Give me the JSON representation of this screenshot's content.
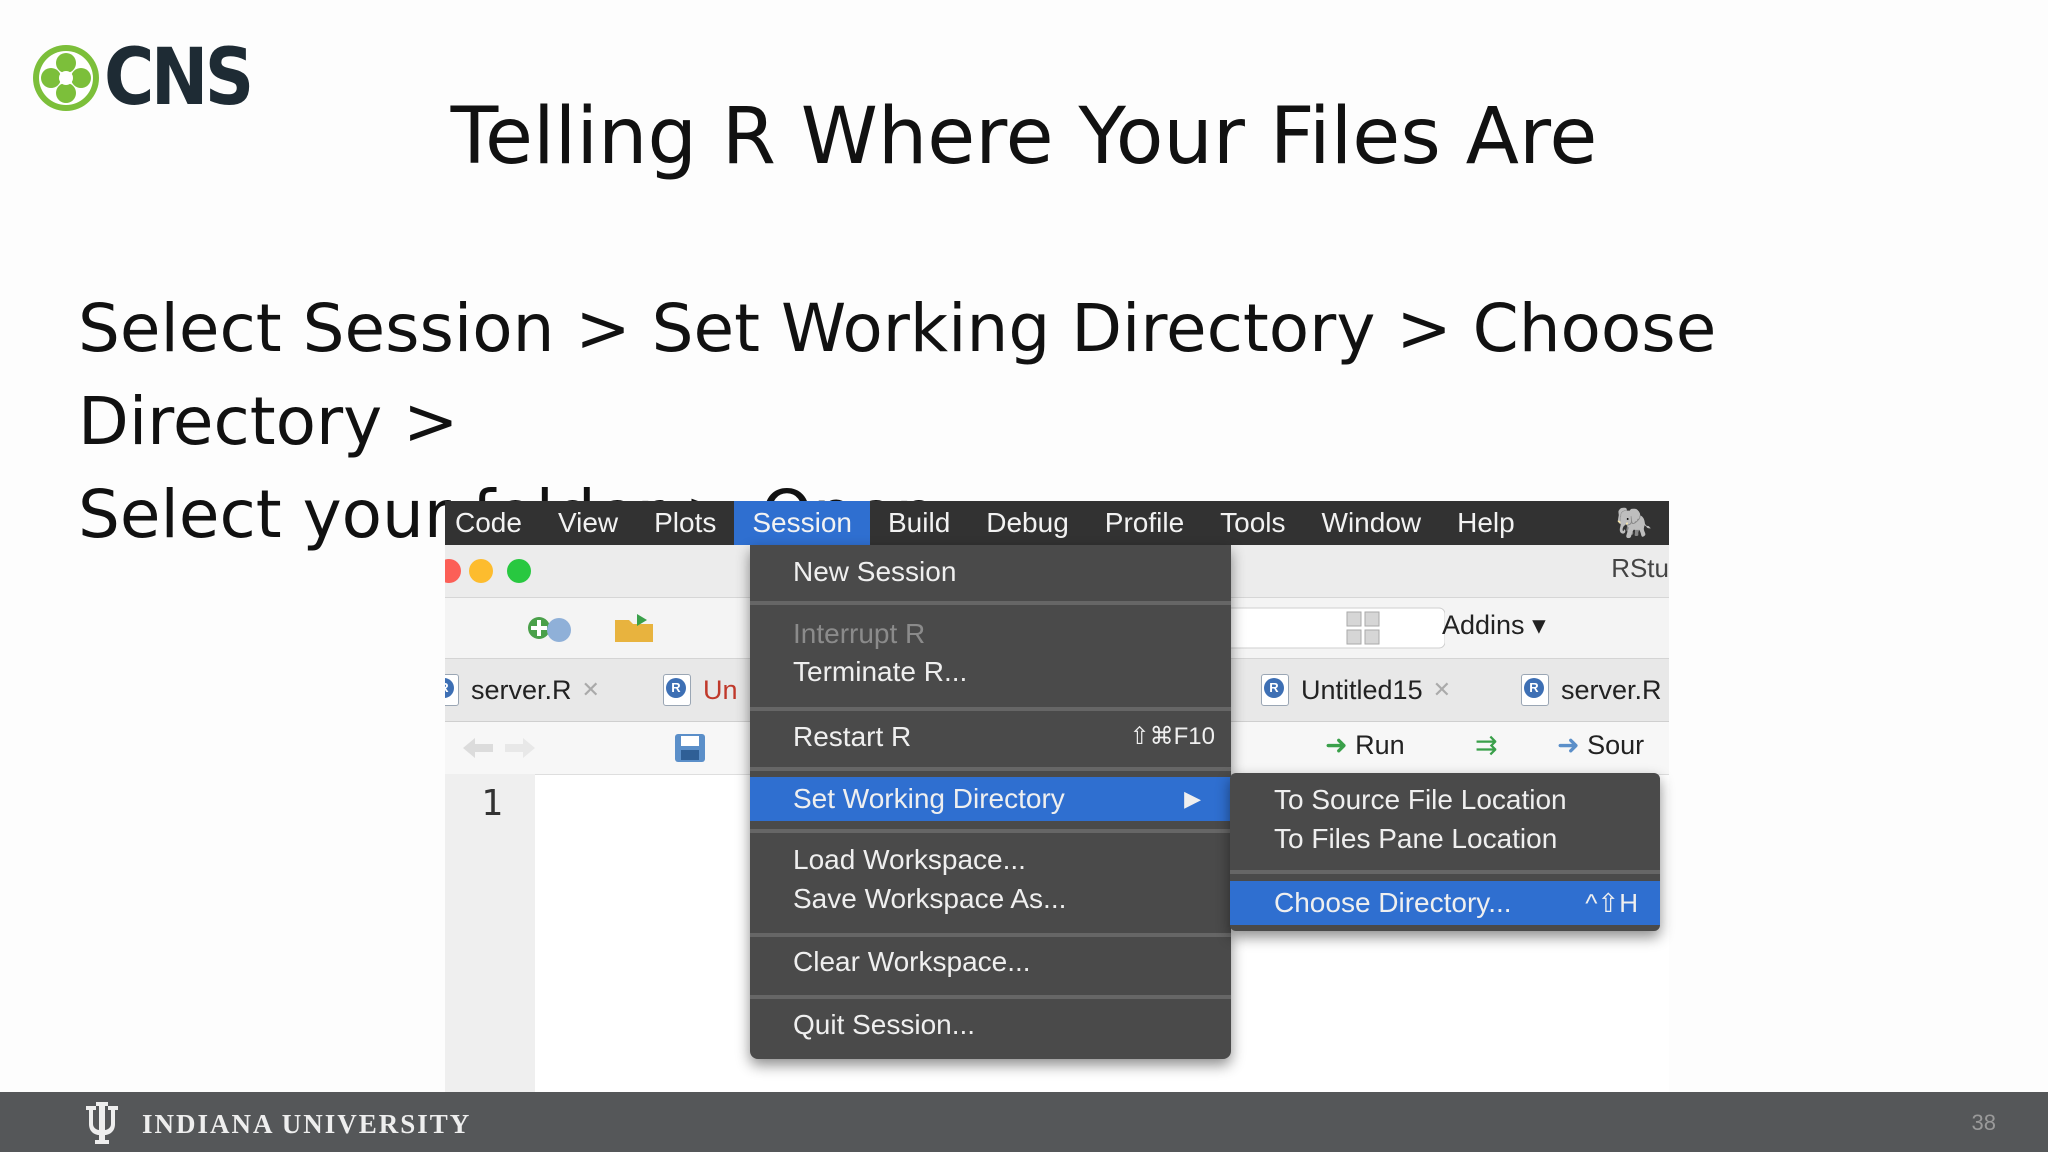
{
  "logo": {
    "text": "CNS"
  },
  "slide": {
    "title": "Telling R Where Your Files Are",
    "body_line1": "Select Session > Set Working Directory > Choose Directory >",
    "body_line2": "Select your folder > Open",
    "page_number": "38"
  },
  "menubar": {
    "items": [
      "Code",
      "View",
      "Plots",
      "Session",
      "Build",
      "Debug",
      "Profile",
      "Tools",
      "Window",
      "Help"
    ],
    "active_item": "Session"
  },
  "window": {
    "title": "RStu"
  },
  "toolbar": {
    "addins_label": "Addins"
  },
  "tabs": [
    {
      "label": "server.R"
    },
    {
      "label": "Un"
    },
    {
      "label": "Untitled15"
    },
    {
      "label": "server.R"
    }
  ],
  "editor": {
    "run_label": "Run",
    "source_label": "Sour",
    "line_number": "1"
  },
  "session_menu": {
    "new_session": "New Session",
    "interrupt_r": "Interrupt R",
    "terminate_r": "Terminate R...",
    "restart_r": "Restart R",
    "restart_shortcut": "⇧⌘F10",
    "set_working_directory": "Set Working Directory",
    "load_workspace": "Load Workspace...",
    "save_workspace_as": "Save Workspace As...",
    "clear_workspace": "Clear Workspace...",
    "quit_session": "Quit Session..."
  },
  "submenu": {
    "to_source_file": "To Source File Location",
    "to_files_pane": "To Files Pane Location",
    "choose_directory": "Choose Directory...",
    "choose_shortcut": "^⇧H"
  },
  "footer": {
    "university": "INDIANA UNIVERSITY"
  },
  "colors": {
    "highlight": "#2f6fd0",
    "menu_bg": "#4a4a4a",
    "menubar_bg": "#323232",
    "logo_green": "#7cbf3a",
    "footer_bg": "#555759"
  },
  "icons": [
    "cns-logo-icon",
    "evernote-icon",
    "r-document-icon",
    "run-arrow-icon",
    "submenu-arrow-icon",
    "iu-trident-icon"
  ]
}
